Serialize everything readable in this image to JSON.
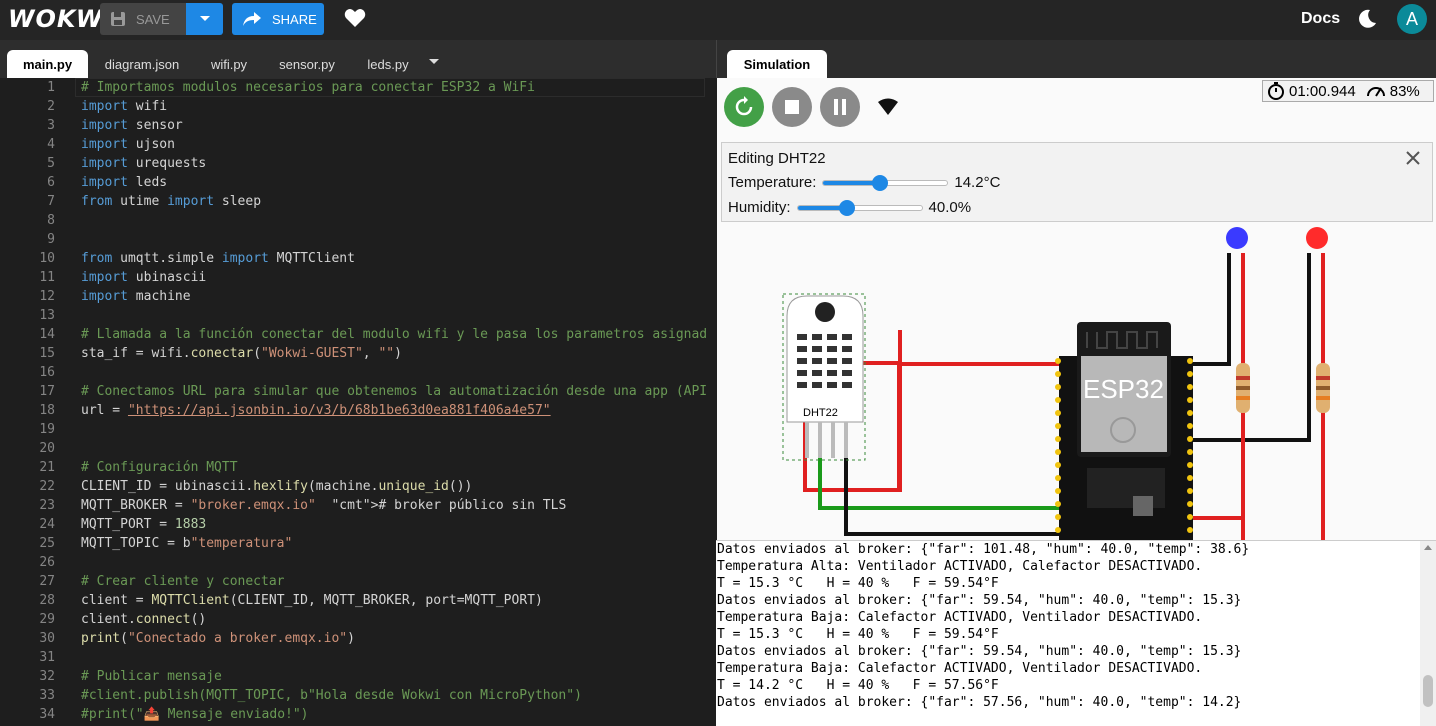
{
  "header": {
    "logo": "WOKWI",
    "save_label": "SAVE",
    "share_label": "SHARE",
    "docs_label": "Docs",
    "avatar_letter": "A"
  },
  "tabs": [
    {
      "label": "main.py",
      "active": true
    },
    {
      "label": "diagram.json"
    },
    {
      "label": "wifi.py"
    },
    {
      "label": "sensor.py"
    },
    {
      "label": "leds.py"
    }
  ],
  "code": [
    {
      "n": "1",
      "text": "# Importamos modulos necesarios para conectar ESP32 a WiFi"
    },
    {
      "n": "2",
      "text": "import wifi"
    },
    {
      "n": "3",
      "text": "import sensor"
    },
    {
      "n": "4",
      "text": "import ujson"
    },
    {
      "n": "5",
      "text": "import urequests"
    },
    {
      "n": "6",
      "text": "import leds"
    },
    {
      "n": "7",
      "text": "from utime import sleep"
    },
    {
      "n": "8",
      "text": ""
    },
    {
      "n": "9",
      "text": ""
    },
    {
      "n": "10",
      "text": "from umqtt.simple import MQTTClient"
    },
    {
      "n": "11",
      "text": "import ubinascii"
    },
    {
      "n": "12",
      "text": "import machine"
    },
    {
      "n": "13",
      "text": ""
    },
    {
      "n": "14",
      "text": "# Llamada a la función conectar del modulo wifi y le pasa los parametros asignad"
    },
    {
      "n": "15",
      "text": "sta_if = wifi.conectar(\"Wokwi-GUEST\", \"\")"
    },
    {
      "n": "16",
      "text": ""
    },
    {
      "n": "17",
      "text": "# Conectamos URL para simular que obtenemos la automatización desde una app (API"
    },
    {
      "n": "18",
      "text": "url = \"https://api.jsonbin.io/v3/b/68b1be63d0ea881f406a4e57\""
    },
    {
      "n": "19",
      "text": ""
    },
    {
      "n": "20",
      "text": ""
    },
    {
      "n": "21",
      "text": "# Configuración MQTT"
    },
    {
      "n": "22",
      "text": "CLIENT_ID = ubinascii.hexlify(machine.unique_id())"
    },
    {
      "n": "23",
      "text": "MQTT_BROKER = \"broker.emqx.io\"  # broker público sin TLS"
    },
    {
      "n": "24",
      "text": "MQTT_PORT = 1883"
    },
    {
      "n": "25",
      "text": "MQTT_TOPIC = b\"temperatura\""
    },
    {
      "n": "26",
      "text": ""
    },
    {
      "n": "27",
      "text": "# Crear cliente y conectar"
    },
    {
      "n": "28",
      "text": "client = MQTTClient(CLIENT_ID, MQTT_BROKER, port=MQTT_PORT)"
    },
    {
      "n": "29",
      "text": "client.connect()"
    },
    {
      "n": "30",
      "text": "print(\"Conectado a broker.emqx.io\")"
    },
    {
      "n": "31",
      "text": ""
    },
    {
      "n": "32",
      "text": "# Publicar mensaje"
    },
    {
      "n": "33",
      "text": "#client.publish(MQTT_TOPIC, b\"Hola desde Wokwi con MicroPython\")"
    },
    {
      "n": "34",
      "text": "#print(\"📤 Mensaje enviado!\")"
    }
  ],
  "simulation": {
    "tab_label": "Simulation",
    "timer": "01:00.944",
    "speed": "83%",
    "editing_title": "Editing DHT22",
    "temperature_label": "Temperature:",
    "temperature_value": "14.2°C",
    "temperature_fraction": 0.46,
    "humidity_label": "Humidity:",
    "humidity_value": "40.0%",
    "humidity_fraction": 0.4,
    "chip_label": "ESP32",
    "sensor_label": "DHT22"
  },
  "console": [
    "Datos enviados al broker: {\"far\": 101.48, \"hum\": 40.0, \"temp\": 38.6}",
    "Temperatura Alta: Ventilador ACTIVADO, Calefactor DESACTIVADO.",
    "T = 15.3 °C   H = 40 %   F = 59.54°F",
    "Datos enviados al broker: {\"far\": 59.54, \"hum\": 40.0, \"temp\": 15.3}",
    "Temperatura Baja: Calefactor ACTIVADO, Ventilador DESACTIVADO.",
    "T = 15.3 °C   H = 40 %   F = 59.54°F",
    "Datos enviados al broker: {\"far\": 59.54, \"hum\": 40.0, \"temp\": 15.3}",
    "Temperatura Baja: Calefactor ACTIVADO, Ventilador DESACTIVADO.",
    "T = 14.2 °C   H = 40 %   F = 57.56°F",
    "Datos enviados al broker: {\"far\": 57.56, \"hum\": 40.0, \"temp\": 14.2}"
  ],
  "colors": {
    "accent": "#1e88e5",
    "restart": "#43a047",
    "avatar": "#0b8a99",
    "wire_red": "#e02020",
    "wire_green": "#1a9a1a"
  }
}
